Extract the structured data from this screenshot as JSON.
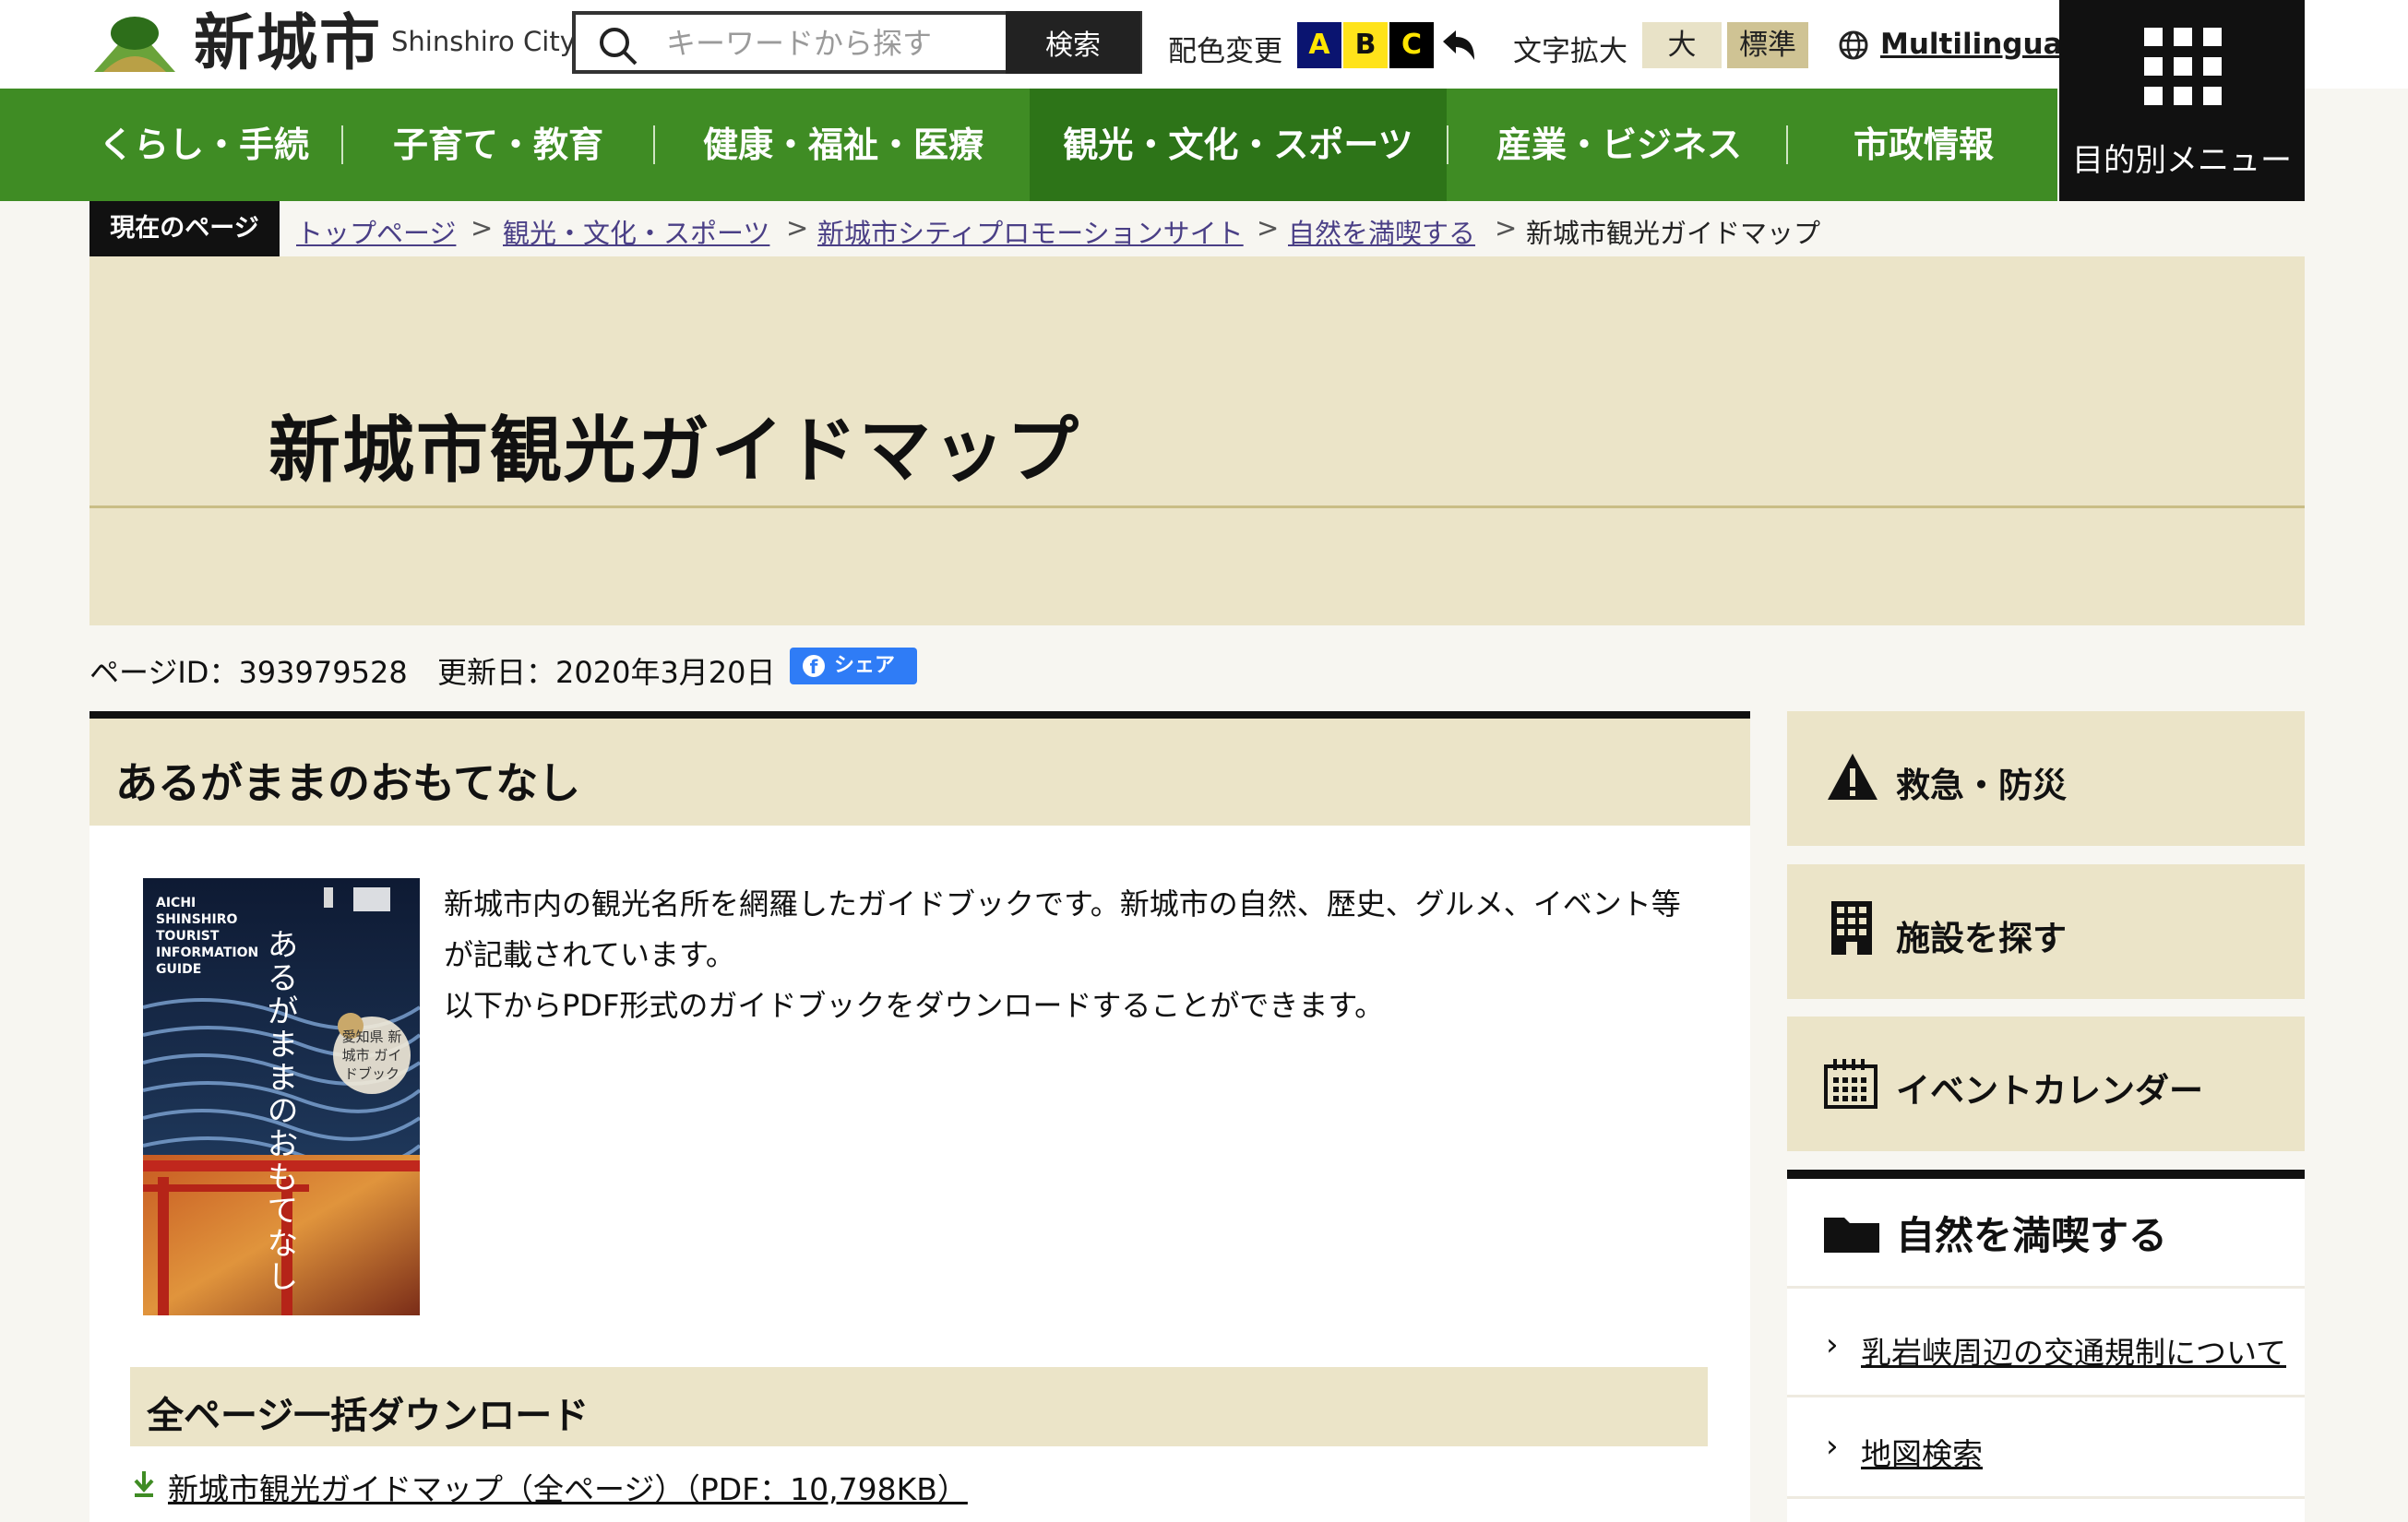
{
  "header": {
    "logo_text": "新城市",
    "logo_sub": "Shinshiro City",
    "search_placeholder": "キーワードから探す",
    "search_button": "検索",
    "color_label": "配色変更",
    "color_options": [
      "A",
      "B",
      "C"
    ],
    "font_label": "文字拡大",
    "font_large": "大",
    "font_normal": "標準",
    "multilingual": "Multilingual"
  },
  "nav": {
    "items": [
      {
        "label": "くらし・手続き"
      },
      {
        "label": "子育て・教育"
      },
      {
        "label": "健康・福祉・医療"
      },
      {
        "label": "観光・文化・スポーツ",
        "active": true
      },
      {
        "label": "産業・ビジネス"
      },
      {
        "label": "市政情報"
      }
    ],
    "menu_label": "目的別メニュー"
  },
  "breadcrumb": {
    "current_label": "現在のページ",
    "items": [
      "トップページ",
      "観光・文化・スポーツ",
      "新城市シティプロモーションサイト",
      "自然を満喫する"
    ],
    "current": "新城市観光ガイドマップ"
  },
  "page": {
    "title": "新城市観光ガイドマップ",
    "page_id": "ページID：393979528",
    "updated": "更新日：2020年3月20日",
    "share": "シェア"
  },
  "main": {
    "section_title": "あるがままのおもてなし",
    "description": [
      "新城市内の観光名所を網羅したガイドブックです。新城市の自然、歴史、グルメ、イベント等が記載されています。",
      "以下からPDF形式のガイドブックをダウンロードすることができます。"
    ],
    "cover": {
      "en_title": "AICHI SHINSHIRO TOURIST INFORMATION GUIDE",
      "jp_title": "あるがままのおもてなし",
      "badge": "愛知県 新城市 ガイドブック"
    },
    "download_heading": "全ページ一括ダウンロード",
    "download_link": "新城市観光ガイドマップ（全ページ）（PDF：10,798KB）"
  },
  "sidebar": {
    "buttons": [
      {
        "label": "救急・防災",
        "icon": "warning-icon"
      },
      {
        "label": "施設を探す",
        "icon": "building-icon"
      },
      {
        "label": "イベントカレンダー",
        "icon": "calendar-icon"
      }
    ],
    "box_title": "自然を満喫する",
    "links": [
      "乳岩峡周辺の交通規制について",
      "地図検索"
    ]
  },
  "colors": {
    "nav_green": "#3f8c24",
    "nav_active": "#2d7418",
    "beige": "#ebe4c8",
    "share_blue": "#2f7cf6"
  }
}
